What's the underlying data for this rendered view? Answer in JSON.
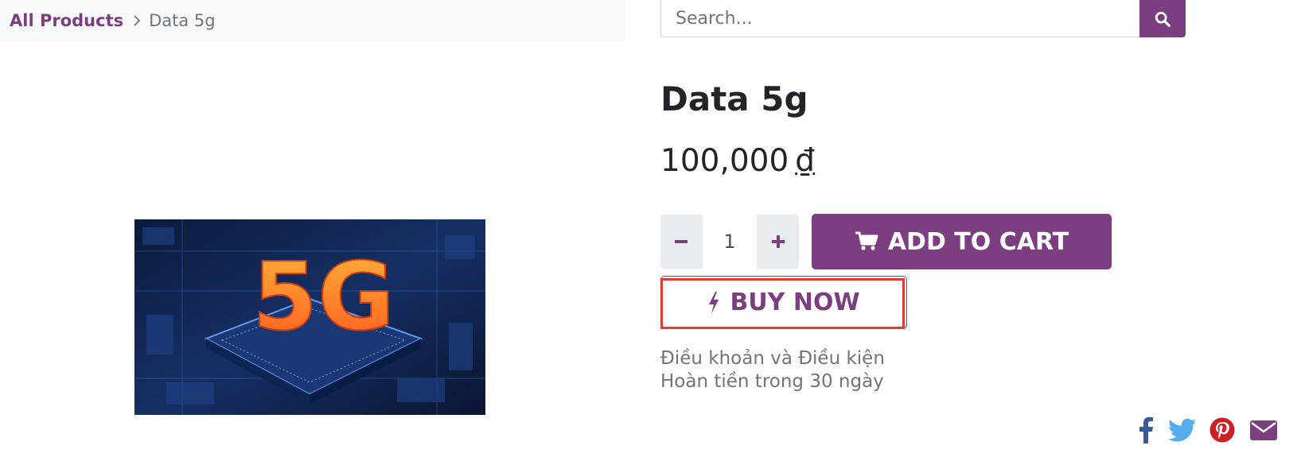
{
  "breadcrumb": {
    "root": "All Products",
    "current": "Data 5g"
  },
  "search": {
    "placeholder": "Search..."
  },
  "product": {
    "title": "Data 5g",
    "price": "100,000",
    "currency": "₫",
    "quantity": "1",
    "image_text": "5G"
  },
  "actions": {
    "add_to_cart": "ADD TO CART",
    "buy_now": "BUY NOW"
  },
  "terms": {
    "line1": "Điều khoản và Điều kiện",
    "line2": "Hoàn tiền trong 30 ngày"
  },
  "share": [
    "facebook-icon",
    "twitter-icon",
    "pinterest-icon",
    "email-icon"
  ],
  "colors": {
    "brand": "#7b3f7f",
    "facebook": "#3b5998",
    "twitter": "#55acee",
    "pinterest": "#cb2027",
    "email": "#7b3f7f",
    "highlight": "#e53935"
  }
}
